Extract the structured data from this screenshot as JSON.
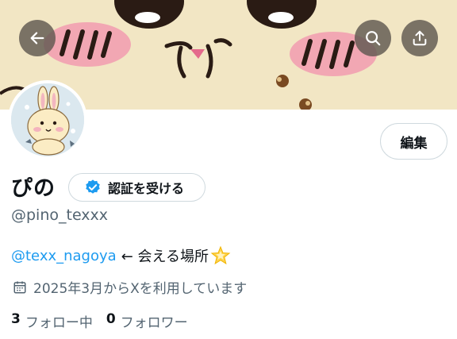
{
  "header": {
    "back_icon": "arrow-left-icon",
    "search_icon": "search-icon",
    "share_icon": "share-icon"
  },
  "profile": {
    "display_name": "ぴの",
    "verify_label": "認証を受ける",
    "handle": "@pino_texxx",
    "edit_label": "編集",
    "bio_mention": "@texx_nagoya",
    "bio_text": "← 会える場所",
    "joined": "2025年3月からXを利用しています",
    "following_count": "3",
    "following_label": "フォロー中",
    "followers_count": "0",
    "followers_label": "フォロワー"
  },
  "colors": {
    "accent": "#1d9bf0",
    "banner": "#f2e6c4",
    "cheek": "#f2a7b3",
    "secondary_text": "#536471"
  }
}
